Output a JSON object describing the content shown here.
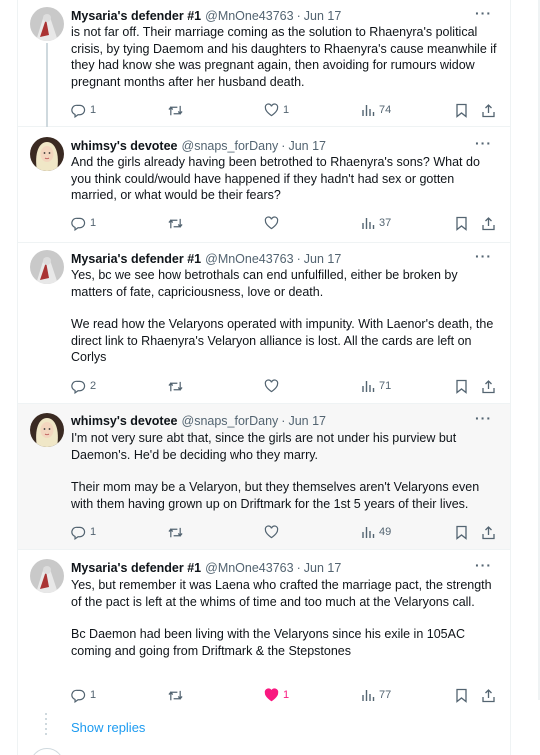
{
  "tweets": [
    {
      "name": "Mysaria's defender #1",
      "handle": "@MnOne43763",
      "date": "Jun 17",
      "more": "···",
      "paragraphs": [
        "is not far off. Their marriage coming as the solution to Rhaenyra's political crisis, by tying Daemom and his daughters to Rhaenyra's cause meanwhile if they had know she was pregnant again, then avoiding for rumours widow pregnant months after her husband death."
      ],
      "replies": "1",
      "retweets": "",
      "likes": "1",
      "views": "74",
      "liked": false
    },
    {
      "name": "whimsy's devotee",
      "handle": "@snaps_forDany",
      "date": "Jun 17",
      "more": "···",
      "paragraphs": [
        "And the girls already having been betrothed to Rhaenyra's sons? What do you think could/would have happened if they hadn't had sex or gotten married, or what would be their fears?"
      ],
      "replies": "1",
      "retweets": "",
      "likes": "",
      "views": "37",
      "liked": false
    },
    {
      "name": "Mysaria's defender #1",
      "handle": "@MnOne43763",
      "date": "Jun 17",
      "more": "···",
      "paragraphs": [
        "Yes, bc we see how betrothals can end unfulfilled, either be broken by matters of fate, capriciousness, love or death.",
        "We read how the Velaryons operated with impunity. With Laenor's death, the direct link to Rhaenyra's Velaryon alliance is lost. All the cards are left on Corlys"
      ],
      "replies": "2",
      "retweets": "",
      "likes": "",
      "views": "71",
      "liked": false
    },
    {
      "name": "whimsy's devotee",
      "handle": "@snaps_forDany",
      "date": "Jun 17",
      "more": "···",
      "paragraphs": [
        "I'm not very sure abt that, since the girls are not under his purview but Daemon's. He'd be deciding who they marry.",
        "Their mom may be a Velaryon, but they themselves aren't Velaryons even with them having grown up on Driftmark for the 1st 5 years of their lives."
      ],
      "replies": "1",
      "retweets": "",
      "likes": "",
      "views": "49",
      "liked": false
    },
    {
      "name": "Mysaria's defender #1",
      "handle": "@MnOne43763",
      "date": "Jun 17",
      "more": "···",
      "paragraphs": [
        "Yes, but remember it was Laena who crafted the marriage pact, the strength of the pact is left at the whims of time and too much at the Velaryons call.",
        "Bc Daemon had been living with the Velaryons since his exile in 105AC coming and going from Driftmark & the Stepstones"
      ],
      "replies": "1",
      "retweets": "",
      "likes": "1",
      "views": "77",
      "liked": true
    }
  ],
  "show_replies": "Show replies",
  "colors": {
    "accent": "#1d9bf0",
    "like": "#f91880",
    "muted": "#536471",
    "highlight_bg": "#f7f7f7"
  },
  "icons": [
    "reply-icon",
    "retweet-icon",
    "heart-icon",
    "views-icon",
    "bookmark-icon",
    "share-icon",
    "more-icon"
  ]
}
